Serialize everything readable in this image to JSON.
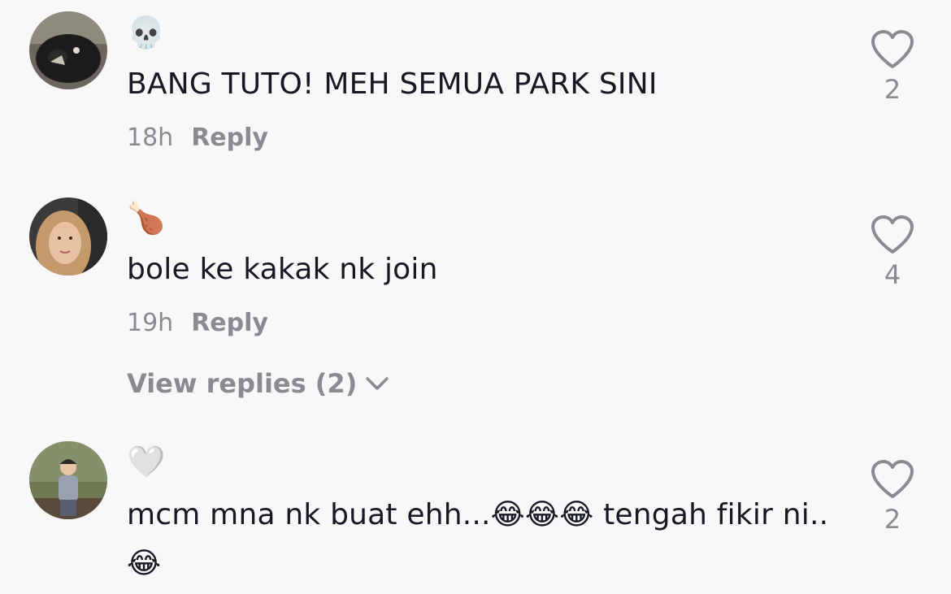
{
  "comments": [
    {
      "username": "💀",
      "text": "BANG TUTO! MEH SEMUA PARK SINI",
      "time": "18h",
      "reply_label": "Reply",
      "likes": "2"
    },
    {
      "username": "🍗",
      "text": "bole ke kakak nk join",
      "time": "19h",
      "reply_label": "Reply",
      "likes": "4",
      "view_replies": "View replies (2)"
    },
    {
      "username": "🤍",
      "text": "mcm mna nk buat ehh...😂😂😂 tengah fikir ni..😂",
      "likes": "2"
    }
  ],
  "colors": {
    "background": "#f8f8f8",
    "text": "#161823",
    "muted": "#8a8b91"
  }
}
